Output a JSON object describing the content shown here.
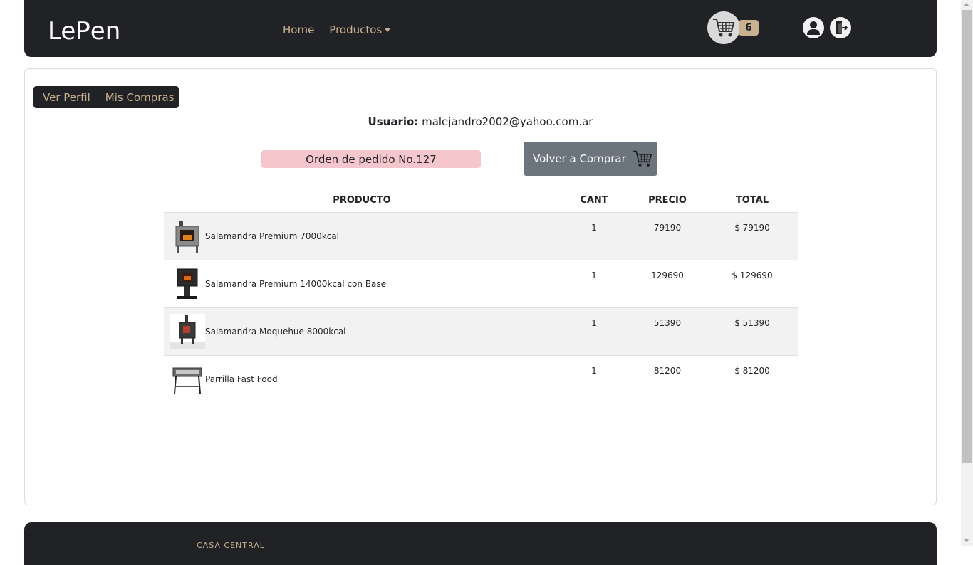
{
  "brand": {
    "logo_text_1": "Le",
    "logo_text_2": "P",
    "logo_text_3": "en"
  },
  "nav": {
    "home_label": "Home",
    "productos_label": "Productos",
    "cart_count": "6"
  },
  "subnav": {
    "ver_perfil_label": "Ver Perfil",
    "mis_compras_label": "Mis Compras"
  },
  "user": {
    "label": "Usuario:",
    "email": "malejandro2002@yahoo.com.ar"
  },
  "order": {
    "label": "Orden de pedido No.127",
    "rebuy_label": "Volver a Comprar"
  },
  "table": {
    "headers": {
      "producto": "PRODUCTO",
      "cant": "CANT",
      "precio": "PRECIO",
      "total": "TOTAL"
    },
    "rows": [
      {
        "name": "Salamandra Premium 7000kcal",
        "cant": "1",
        "precio": "79190",
        "total": "$ 79190"
      },
      {
        "name": "Salamandra Premium 14000kcal con Base",
        "cant": "1",
        "precio": "129690",
        "total": "$ 129690"
      },
      {
        "name": "Salamandra Moquehue 8000kcal",
        "cant": "1",
        "precio": "51390",
        "total": "$ 51390"
      },
      {
        "name": "Parrilla Fast Food",
        "cant": "1",
        "precio": "81200",
        "total": "$ 81200"
      }
    ]
  },
  "footer": {
    "title": "CASA CENTRAL"
  },
  "colors": {
    "dark": "#212226",
    "accent": "#c9b08f",
    "order_bg": "#f5c6cb",
    "button_gray": "#6c757d"
  },
  "icons": {
    "cart": "cart-icon",
    "user": "user-icon",
    "logout": "logout-icon"
  }
}
